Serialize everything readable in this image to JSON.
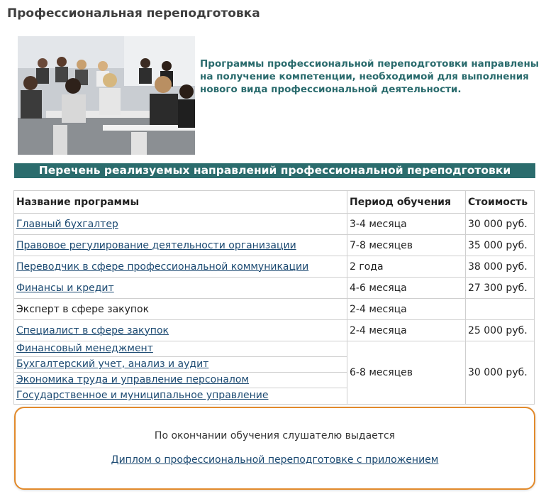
{
  "page": {
    "title": "Профессиональная переподготовка"
  },
  "intro": {
    "text": "Программы профессиональной переподготовки направлены на получение компетенции, необходимой для выполнения нового вида профессиональной деятельности."
  },
  "section": {
    "banner": "Перечень реализуемых направлений профессиональной переподготовки"
  },
  "table": {
    "headers": {
      "name": "Название программы",
      "period": "Период обучения",
      "cost": "Стоимость"
    },
    "rows": [
      {
        "name": "Главный бухгалтер",
        "period": "3-4  месяца",
        "cost": "30 000 руб."
      },
      {
        "name": "Правовое регулирование деятельности организации ",
        "period": "7-8 месяцев",
        "cost": "35 000 руб."
      },
      {
        "name": "Переводчик в сфере профессиональной коммуникации",
        "period": "2 года",
        "cost": "38 000 руб."
      },
      {
        "name": "Финансы и кредит",
        "period": "4-6 месяца",
        "cost": "27 300 руб."
      },
      {
        "name": "Эксперт в сфере закупок",
        "period": "2-4 месяца",
        "cost": ""
      },
      {
        "name": "Специалист в сфере закупок",
        "period": "2-4 месяца",
        "cost": "25 000 руб."
      }
    ],
    "group": {
      "names": [
        "Финансовый менеджмент",
        "Бухгалтерский учет, анализ и аудит",
        "Экономика труда и управление персоналом",
        "Государственное и муниципальное управление"
      ],
      "period": "6-8 месяцев",
      "cost": "30 000 руб."
    }
  },
  "note": {
    "text": "По окончании обучения слушателю выдается",
    "link": "Диплом о профессиональной переподготовке с приложением"
  },
  "colors": {
    "accent_teal": "#2b6c6d",
    "link_blue": "#1c4a72",
    "border_orange": "#e28a2b"
  },
  "photo": {
    "icon": "classroom-photo"
  }
}
